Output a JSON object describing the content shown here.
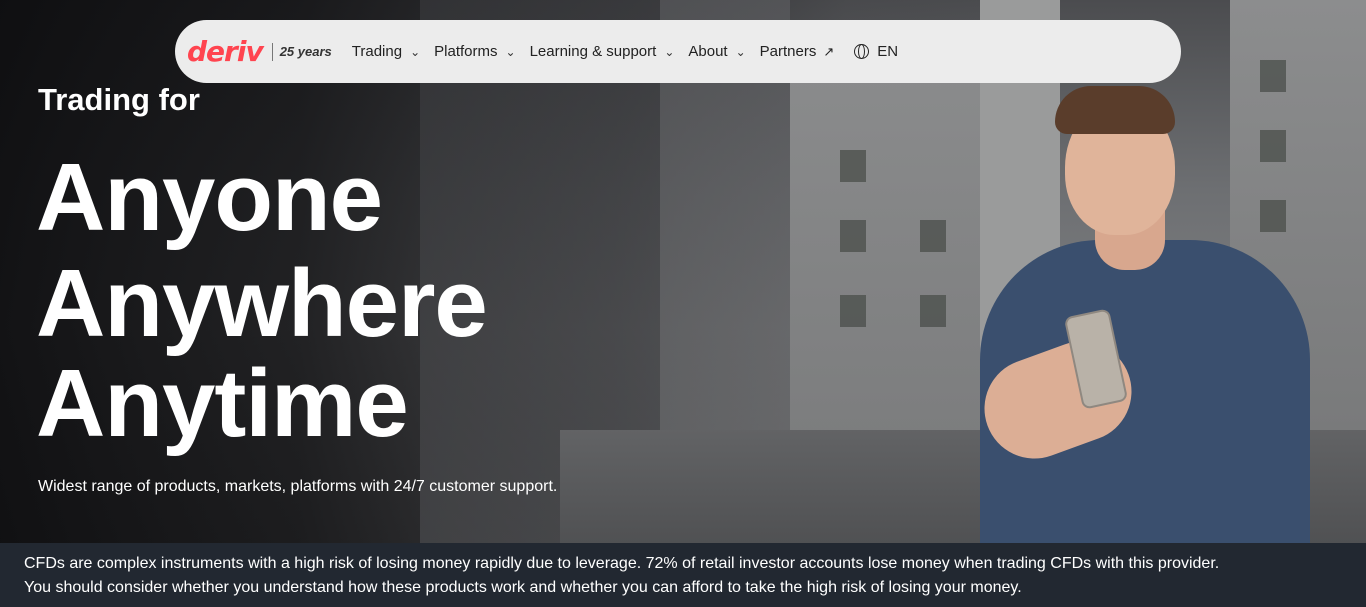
{
  "nav": {
    "logo": "deriv",
    "years": "25 years",
    "items": [
      {
        "label": "Trading",
        "has_dropdown": true
      },
      {
        "label": "Platforms",
        "has_dropdown": true
      },
      {
        "label": "Learning & support",
        "has_dropdown": true
      },
      {
        "label": "About",
        "has_dropdown": true
      },
      {
        "label": "Partners",
        "external": true
      }
    ],
    "language": "EN"
  },
  "hero": {
    "pre_title": "Trading for",
    "line1": "Anyone",
    "line2": "Anywhere",
    "line3": "Anytime",
    "subtitle": "Widest range of products, markets, platforms with 24/7 customer support."
  },
  "disclaimer": {
    "line1": "CFDs are complex instruments with a high risk of losing money rapidly due to leverage. 72% of retail investor accounts lose money when trading CFDs with this provider.",
    "line2": "You should consider whether you understand how these products work and whether you can afford to take the high risk of losing your money."
  },
  "colors": {
    "brand": "#ff444f",
    "disclaimer_bg": "#222831",
    "nav_bg": "#ececec"
  },
  "icons": [
    "chevron-down-icon",
    "external-arrow-icon",
    "globe-icon"
  ]
}
